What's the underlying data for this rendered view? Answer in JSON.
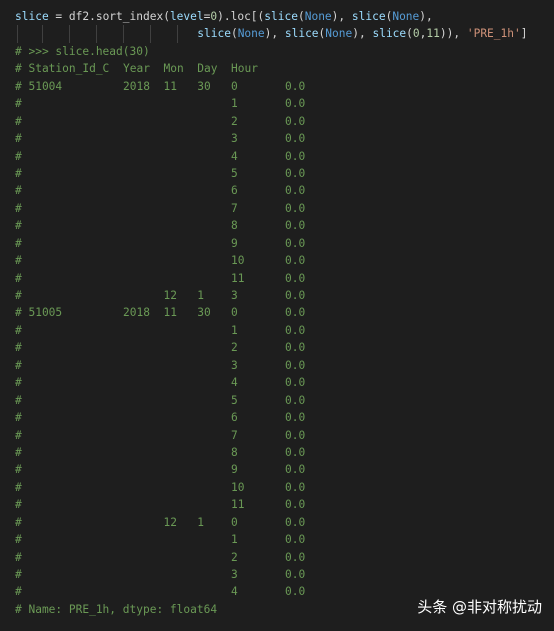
{
  "code": {
    "line1": [
      {
        "t": "slice",
        "c": "var"
      },
      {
        "t": " = df2.sort_index(",
        "c": ""
      },
      {
        "t": "level",
        "c": "var"
      },
      {
        "t": "=",
        "c": ""
      },
      {
        "t": "0",
        "c": "num"
      },
      {
        "t": ").loc[(",
        "c": ""
      },
      {
        "t": "slice",
        "c": "var"
      },
      {
        "t": "(",
        "c": ""
      },
      {
        "t": "None",
        "c": "kw"
      },
      {
        "t": "), ",
        "c": ""
      },
      {
        "t": "slice",
        "c": "var"
      },
      {
        "t": "(",
        "c": ""
      },
      {
        "t": "None",
        "c": "kw"
      },
      {
        "t": "),",
        "c": ""
      }
    ],
    "line2": [
      {
        "t": "slice",
        "c": "var"
      },
      {
        "t": "(",
        "c": ""
      },
      {
        "t": "None",
        "c": "kw"
      },
      {
        "t": "), ",
        "c": ""
      },
      {
        "t": "slice",
        "c": "var"
      },
      {
        "t": "(",
        "c": ""
      },
      {
        "t": "None",
        "c": "kw"
      },
      {
        "t": "), ",
        "c": ""
      },
      {
        "t": "slice",
        "c": "var"
      },
      {
        "t": "(",
        "c": ""
      },
      {
        "t": "0",
        "c": "num"
      },
      {
        "t": ",",
        "c": ""
      },
      {
        "t": "11",
        "c": "num"
      },
      {
        "t": ")), ",
        "c": ""
      },
      {
        "t": "'PRE_1h'",
        "c": "str"
      },
      {
        "t": "]",
        "c": ""
      }
    ],
    "prompt": "# >>> slice.head(30)",
    "header": [
      "# Station_Id_C",
      "Year",
      "Mon",
      "Day",
      "Hour"
    ],
    "rows": [
      [
        "# 51004",
        "2018",
        "11",
        "30",
        "0",
        "0.0"
      ],
      [
        "#",
        "",
        "",
        "",
        "1",
        "0.0"
      ],
      [
        "#",
        "",
        "",
        "",
        "2",
        "0.0"
      ],
      [
        "#",
        "",
        "",
        "",
        "3",
        "0.0"
      ],
      [
        "#",
        "",
        "",
        "",
        "4",
        "0.0"
      ],
      [
        "#",
        "",
        "",
        "",
        "5",
        "0.0"
      ],
      [
        "#",
        "",
        "",
        "",
        "6",
        "0.0"
      ],
      [
        "#",
        "",
        "",
        "",
        "7",
        "0.0"
      ],
      [
        "#",
        "",
        "",
        "",
        "8",
        "0.0"
      ],
      [
        "#",
        "",
        "",
        "",
        "9",
        "0.0"
      ],
      [
        "#",
        "",
        "",
        "",
        "10",
        "0.0"
      ],
      [
        "#",
        "",
        "",
        "",
        "11",
        "0.0"
      ],
      [
        "#",
        "",
        "12",
        "1",
        "3",
        "0.0"
      ],
      [
        "# 51005",
        "2018",
        "11",
        "30",
        "0",
        "0.0"
      ],
      [
        "#",
        "",
        "",
        "",
        "1",
        "0.0"
      ],
      [
        "#",
        "",
        "",
        "",
        "2",
        "0.0"
      ],
      [
        "#",
        "",
        "",
        "",
        "3",
        "0.0"
      ],
      [
        "#",
        "",
        "",
        "",
        "4",
        "0.0"
      ],
      [
        "#",
        "",
        "",
        "",
        "5",
        "0.0"
      ],
      [
        "#",
        "",
        "",
        "",
        "6",
        "0.0"
      ],
      [
        "#",
        "",
        "",
        "",
        "7",
        "0.0"
      ],
      [
        "#",
        "",
        "",
        "",
        "8",
        "0.0"
      ],
      [
        "#",
        "",
        "",
        "",
        "9",
        "0.0"
      ],
      [
        "#",
        "",
        "",
        "",
        "10",
        "0.0"
      ],
      [
        "#",
        "",
        "",
        "",
        "11",
        "0.0"
      ],
      [
        "#",
        "",
        "12",
        "1",
        "0",
        "0.0"
      ],
      [
        "#",
        "",
        "",
        "",
        "1",
        "0.0"
      ],
      [
        "#",
        "",
        "",
        "",
        "2",
        "0.0"
      ],
      [
        "#",
        "",
        "",
        "",
        "3",
        "0.0"
      ],
      [
        "#",
        "",
        "",
        "",
        "4",
        "0.0"
      ]
    ],
    "footer": "# Name: PRE_1h, dtype: float64"
  },
  "watermark": "头条 @非对称扰动",
  "colors": {
    "background": "#1e1e1e",
    "comment": "#6a9955",
    "variable": "#9cdcfe",
    "keyword": "#569cd6",
    "string": "#ce9178",
    "number": "#b5cea8"
  }
}
